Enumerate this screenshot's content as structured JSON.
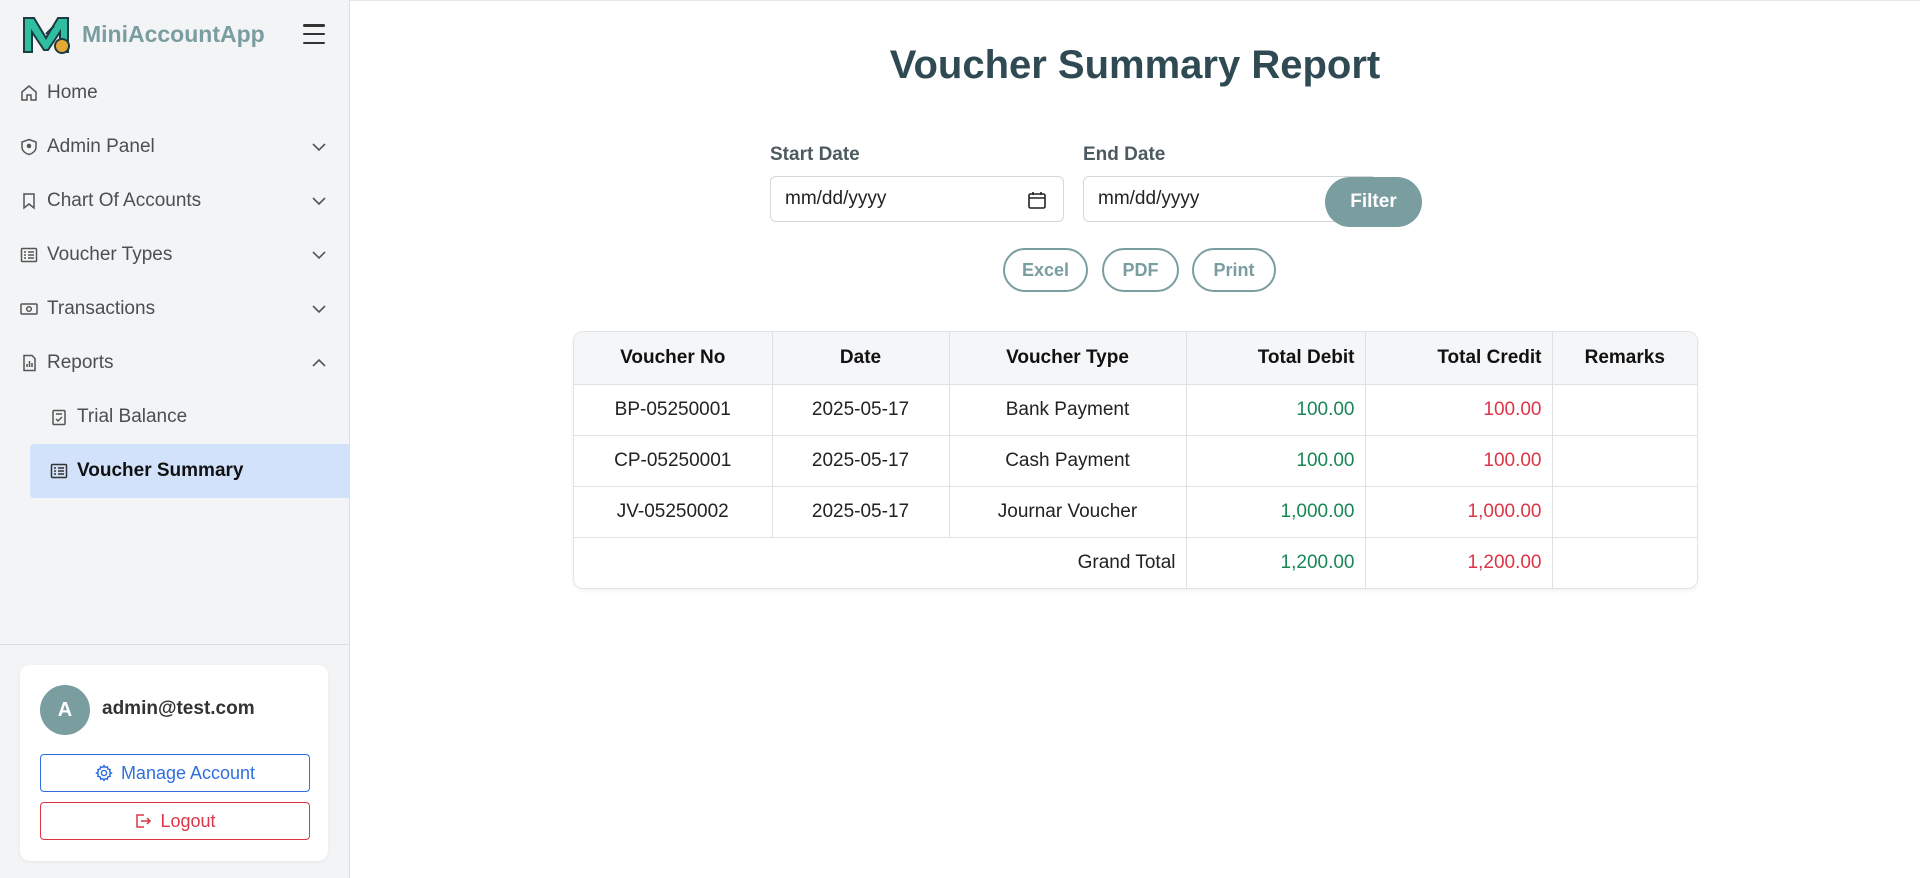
{
  "app": {
    "name": "MiniAccountApp",
    "logo_letter": "M"
  },
  "sidebar": {
    "items": [
      {
        "label": "Home",
        "icon": "home-icon"
      },
      {
        "label": "Admin Panel",
        "icon": "shield-icon",
        "expandable": true
      },
      {
        "label": "Chart Of Accounts",
        "icon": "bookmark-icon",
        "expandable": true
      },
      {
        "label": "Voucher Types",
        "icon": "list-icon",
        "expandable": true
      },
      {
        "label": "Transactions",
        "icon": "cash-icon",
        "expandable": true
      },
      {
        "label": "Reports",
        "icon": "report-icon",
        "expandable": true,
        "expanded": true
      }
    ],
    "sub_items": [
      {
        "label": "Trial Balance",
        "icon": "clipboard-check-icon"
      },
      {
        "label": "Voucher Summary",
        "icon": "list-icon",
        "active": true
      }
    ]
  },
  "user": {
    "avatar_initial": "A",
    "email": "admin@test.com",
    "manage_label": "Manage Account",
    "logout_label": "Logout"
  },
  "main": {
    "title": "Voucher Summary Report",
    "start_date_label": "Start Date",
    "end_date_label": "End Date",
    "start_date_placeholder": "mm/dd/yyyy",
    "end_date_placeholder": "mm/dd/yyyy",
    "filter_label": "Filter",
    "export_buttons": [
      "Excel",
      "PDF",
      "Print"
    ]
  },
  "table": {
    "headers": [
      "Voucher No",
      "Date",
      "Voucher Type",
      "Total Debit",
      "Total Credit",
      "Remarks"
    ],
    "rows": [
      {
        "voucher_no": "BP-05250001",
        "date": "2025-05-17",
        "type": "Bank Payment",
        "debit": "100.00",
        "credit": "100.00",
        "remarks": ""
      },
      {
        "voucher_no": "CP-05250001",
        "date": "2025-05-17",
        "type": "Cash Payment",
        "debit": "100.00",
        "credit": "100.00",
        "remarks": ""
      },
      {
        "voucher_no": "JV-05250002",
        "date": "2025-05-17",
        "type": "Journar Voucher",
        "debit": "1,000.00",
        "credit": "1,000.00",
        "remarks": ""
      }
    ],
    "grand_total": {
      "label": "Grand Total",
      "debit": "1,200.00",
      "credit": "1,200.00"
    }
  },
  "colors": {
    "accent": "#7a9ea0",
    "active_bg": "#d3e2fb",
    "debit": "#198754",
    "credit": "#dc3545",
    "primary": "#2f6fe0"
  }
}
